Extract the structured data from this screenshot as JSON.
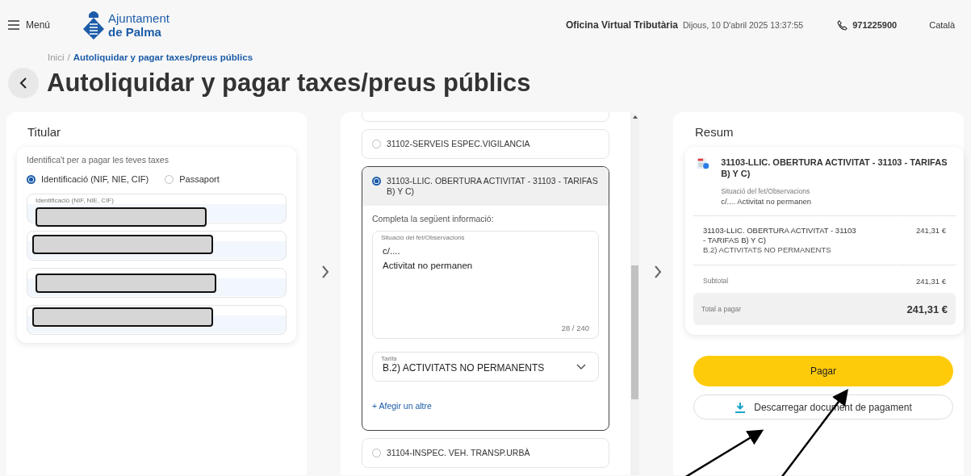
{
  "header": {
    "menu_label": "Menú",
    "logo_line1": "Ajuntament",
    "logo_line2": "de Palma",
    "office": "Oficina Virtual Tributària",
    "datetime": "Dijous, 10 D'abril 2025 13:37:55",
    "phone": "971225900",
    "language": "Català"
  },
  "breadcrumb": {
    "home": "Inici",
    "separator": "/",
    "current": "Autoliquidar y pagar taxes/preus públics"
  },
  "page_title": "Autoliquidar y pagar taxes/preus públics",
  "titular": {
    "title": "Titular",
    "intro": "Identifica't per a pagar les teves taxes",
    "id_types": [
      {
        "label": "Identificació (NIF, NIE, CIF)",
        "selected": true
      },
      {
        "label": "Passaport",
        "selected": false
      }
    ],
    "fields": [
      {
        "label": "Identificació (NIF, NIE, CIF)",
        "kind": "redacted"
      },
      {
        "kind": "redacted"
      },
      {
        "kind": "redacted"
      },
      {
        "kind": "redacted"
      }
    ]
  },
  "options": [
    {
      "kind": "cut",
      "selected": false
    },
    {
      "label": "31102-SERVEIS ESPEC.VIGILANCIA",
      "selected": false
    },
    {
      "label": "31103-LLIC. OBERTURA ACTIVITAT - 31103 - TARIFAS B) Y C)",
      "selected": true,
      "details": {
        "prompt": "Completa la següent informació:",
        "observations": {
          "label": "Situació del fet/Observacions",
          "value": "c/....\nActivitat no permanen",
          "counter": "28 / 240"
        },
        "tarifa": {
          "label": "Tarifa",
          "value": "B.2) ACTIVITATS NO PERMANENTS"
        },
        "add_link": "+ Afegir un altre"
      }
    },
    {
      "label": "31104-INSPEC. VEH. TRANSP.URBÀ",
      "selected": false
    }
  ],
  "summary": {
    "title": "Resum",
    "item_title": "31103-LLIC. OBERTURA ACTIVITAT - 31103 - TARIFAS B) Y C)",
    "obs_label": "Situació del fet/Observacions",
    "obs_value": "c/.... Activitat no permanen",
    "line": {
      "title": "31103-LLIC. OBERTURA ACTIVITAT - 31103 - TARIFAS B) Y C)",
      "subtitle": "B.2) ACTIVITATS NO PERMANENTS",
      "amount": "241,31 €"
    },
    "subtotal_label": "Subtotal",
    "subtotal": "241,31 €",
    "total_label": "Total a pagar",
    "total": "241,31 €"
  },
  "pay_button": "Pagar",
  "download_button": "Descarregar document de pagament"
}
